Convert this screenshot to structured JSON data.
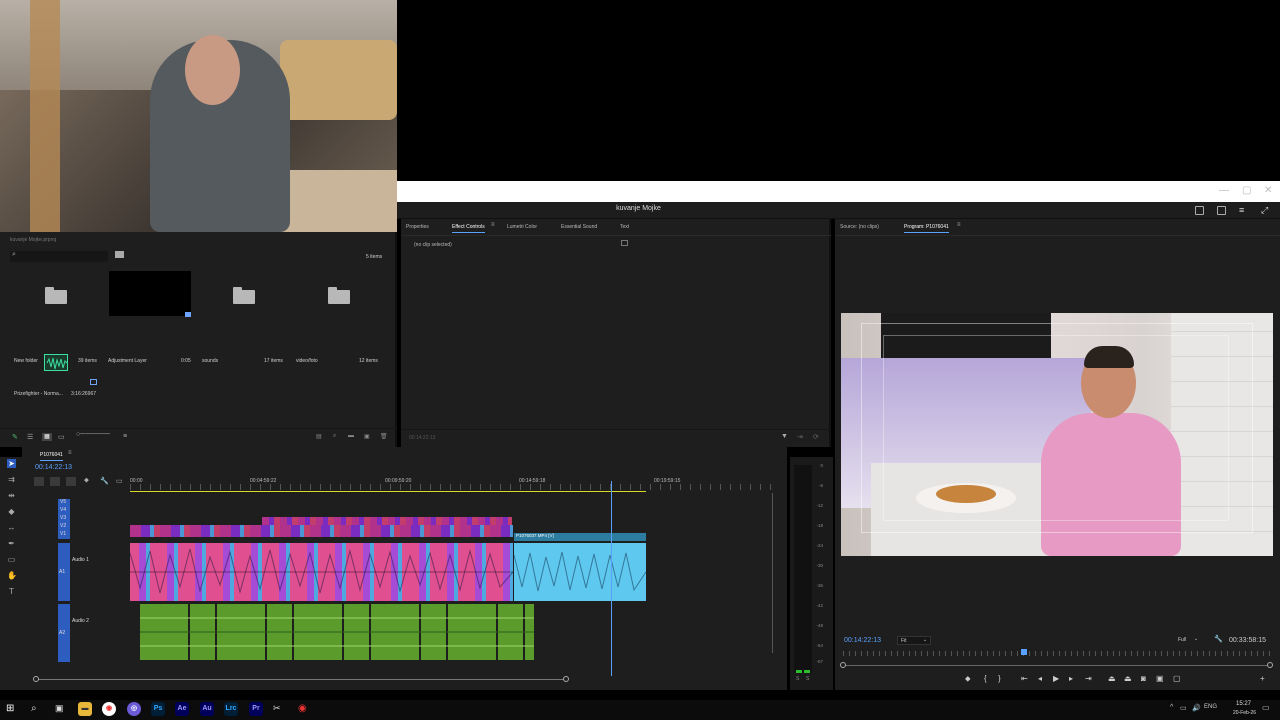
{
  "app": {
    "window_title": "kuvanje Mojke",
    "window_controls": [
      "—",
      "▢",
      "✕"
    ]
  },
  "project": {
    "path": "kuvanje Mojke.prproj",
    "search_placeholder": "",
    "items_count": "5 items",
    "items": [
      {
        "name": "New folder",
        "meta": "39 items",
        "icon": "folder-icon"
      },
      {
        "name": "Adjustment Layer",
        "meta": "0:05",
        "icon": "adjustment-layer-thumbnail"
      },
      {
        "name": "sounds",
        "meta": "17 items",
        "icon": "folder-icon"
      },
      {
        "name": "video/foto",
        "meta": "12 items",
        "icon": "folder-icon"
      },
      {
        "name": "Prizefighter - Norma...",
        "meta": "3:16:26967",
        "icon": "audio-clip-thumbnail"
      }
    ]
  },
  "effects": {
    "tabs": [
      "Properties",
      "Effect Controls",
      "Lumetri Color",
      "Essential Sound",
      "Text"
    ],
    "active_tab": "Effect Controls",
    "no_clip": "(no clip selected)",
    "timecode": "00:14:22:13"
  },
  "monitor": {
    "tabs": [
      "Source: (no clips)",
      "Program: P1076041"
    ],
    "active_tab": "Program: P1076041",
    "current_time": "00:14:22:13",
    "fit": "Fit",
    "quality": "Full",
    "duration": "00:33:58:15",
    "playhead_fraction": 0.42
  },
  "timeline": {
    "sequence_name": "P1076041",
    "timecode": "00:14:22:13",
    "ruler": [
      "00:00",
      "00:04:59:22",
      "00:09:59:20",
      "00:14:59:18",
      "00:19:59:15"
    ],
    "video_tracks": [
      "V5",
      "V4",
      "V3",
      "V2",
      "V1"
    ],
    "audio_tracks": [
      {
        "id": "A1",
        "name": "Audio 1"
      },
      {
        "id": "A2",
        "name": "Audio 2"
      }
    ],
    "clip_label": "P1076037.MP4 [V]",
    "playhead_fraction": 0.74
  },
  "meter": {
    "scale": [
      "0",
      "-6",
      "-12",
      "-18",
      "-24",
      "-30",
      "-36",
      "-42",
      "-48",
      "-54",
      "-57"
    ],
    "channels": [
      "S",
      "S"
    ]
  },
  "taskbar": {
    "apps": [
      "Ps",
      "Ae",
      "Au",
      "Lrc",
      "Pr"
    ],
    "language": "ENG",
    "time": "15:27",
    "date": "20-Feb-26"
  }
}
